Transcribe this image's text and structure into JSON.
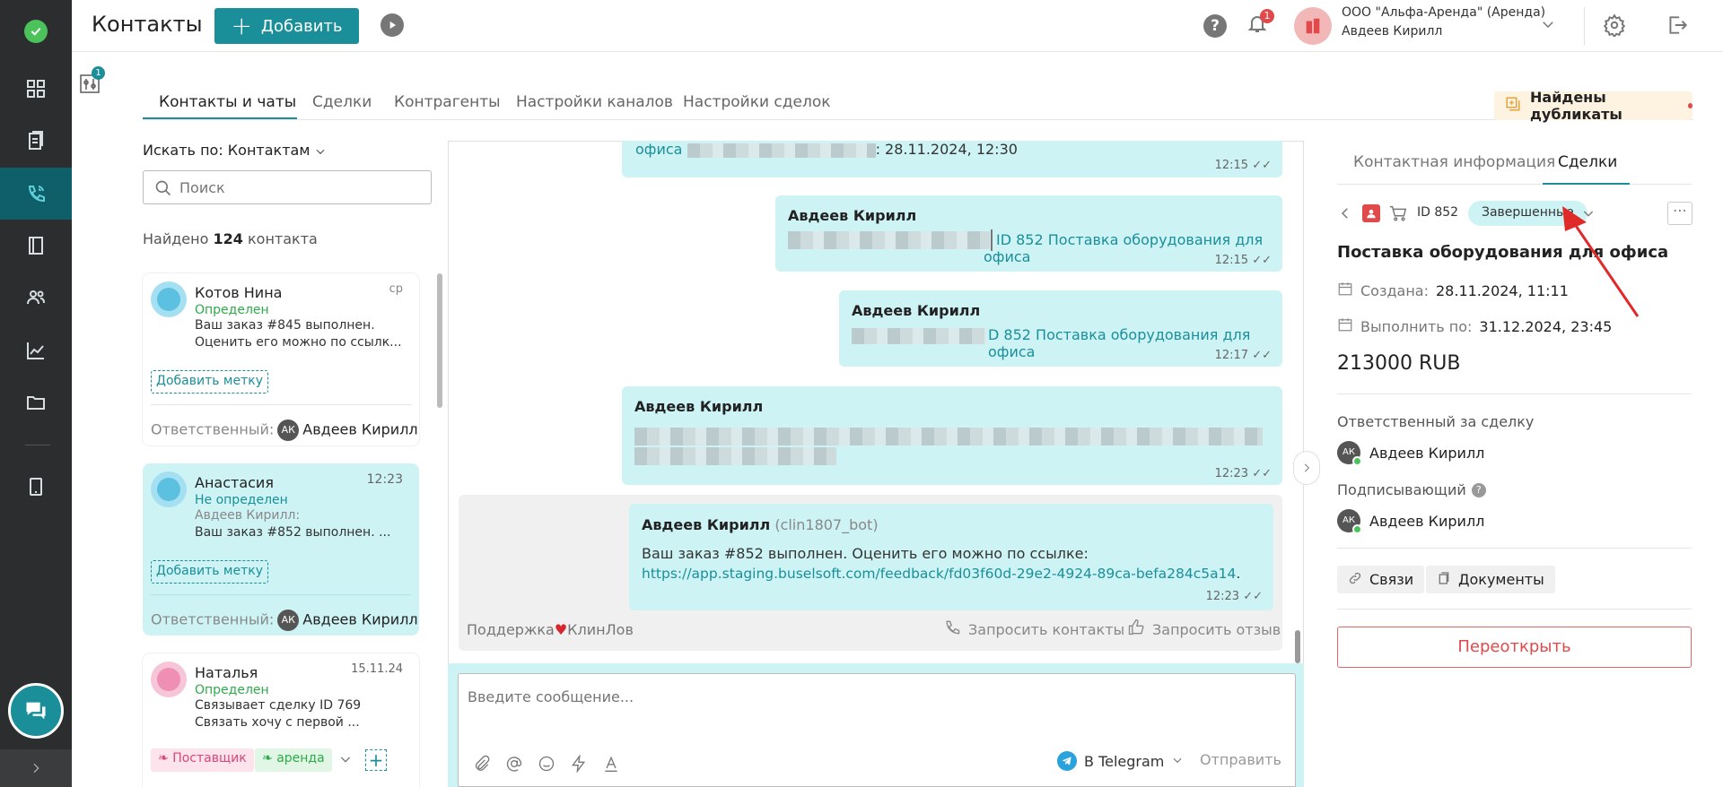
{
  "app": {
    "page_title": "Контакты",
    "add_label": "Добавить"
  },
  "topbar": {
    "notifications_count": "1",
    "org_name": "ООО \"Альфа-Аренда\" (Аренда)",
    "user_name": "Авдеев Кирилл"
  },
  "filter_badge": "1",
  "tabs": [
    "Контакты и чаты",
    "Сделки",
    "Контрагенты",
    "Настройки каналов",
    "Настройки сделок"
  ],
  "duplicates_label": "Найдены дубликаты",
  "search": {
    "by_label": "Искать по: Контактам",
    "placeholder": "Поиск"
  },
  "found": {
    "prefix": "Найдено",
    "count": "124",
    "suffix": "контакта"
  },
  "contacts": [
    {
      "name": "Котов Нина",
      "status": "Определен",
      "time": "ср",
      "line1": "Ваш заказ #845 выполнен.",
      "line2": "Оценить его можно по ссылк...",
      "mark": "Добавить метку",
      "resp_label": "Ответственный:",
      "resp_initials": "АК",
      "resp_name": "Авдеев Кирилл"
    },
    {
      "name": "Анастасия",
      "status": "Не определен",
      "time": "12:23",
      "line1": "Авдеев Кирилл:",
      "line2": "Ваш заказ #852 выполнен. ...",
      "mark": "Добавить метку",
      "resp_label": "Ответственный:",
      "resp_initials": "АК",
      "resp_name": "Авдеев Кирилл"
    },
    {
      "name": "Наталья",
      "status": "Определен",
      "time": "15.11.24",
      "line1": "Связывает сделку ID 769",
      "line2": "Связать хочу с первой ...",
      "tags": [
        "Поставщик",
        "аренда"
      ]
    }
  ],
  "chat": {
    "msg0": {
      "text_prefix": "офиса",
      "text_date": ": 28.11.2024, 12:30",
      "time": "12:15"
    },
    "msg1": {
      "author": "Авдеев Кирилл",
      "link": "ID 852 Поставка оборудования для офиса",
      "time": "12:15"
    },
    "msg2": {
      "author": "Авдеев Кирилл",
      "link": "D 852 Поставка оборудования для офиса",
      "time": "12:17"
    },
    "msg3": {
      "author": "Авдеев Кирилл",
      "time": "12:23"
    },
    "bot": {
      "author": "Авдеев Кирилл",
      "bot_name": "(clin1807_bot)",
      "text": "Ваш заказ #852 выполнен. Оценить его можно по ссылке:",
      "url": "https://app.staging.buselsoft.com/feedback/fd03f60d-29e2-4924-89ca-befa284c5a14",
      "url_tail": ".",
      "time": "12:23"
    },
    "channel_left": "Поддержка",
    "channel_right": "КлинЛов",
    "request_contacts": "Запросить контакты",
    "request_review": "Запросить отзыв",
    "input_placeholder": "Введите сообщение...",
    "send_via": "В Telegram",
    "send": "Отправить"
  },
  "right": {
    "tabs": [
      "Контактная информация",
      "Сделки"
    ],
    "deal_id": "ID 852",
    "stage": "Завершенные",
    "deal_title": "Поставка оборудования для офиса",
    "created_label": "Создана:",
    "created": "28.11.2024, 11:11",
    "due_label": "Выполнить по:",
    "due": "31.12.2024, 23:45",
    "amount": "213000 RUB",
    "responsible_label": "Ответственный за сделку",
    "responsible": "Авдеев Кирилл",
    "signer_label": "Подписывающий",
    "signer": "Авдеев Кирилл",
    "links_label": "Связи",
    "docs_label": "Документы",
    "reopen": "Переоткрыть"
  },
  "colors": {
    "accent": "#1a8f9a",
    "sidebar": "#2b2d2f",
    "bubble": "#cdf3f5",
    "alert": "#e04a4a"
  }
}
